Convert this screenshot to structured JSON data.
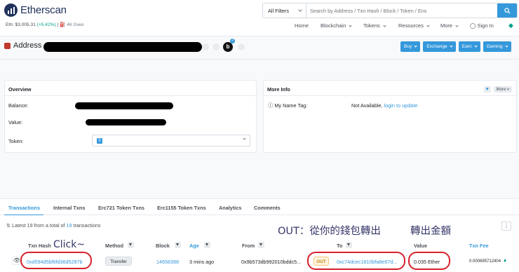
{
  "header": {
    "logo_text": "Etherscan",
    "eth_price_label": "Eth: $3,005.31",
    "eth_price_change": "(+5.42%)",
    "separator": "|",
    "gas": "46 Gwei",
    "search_filter": "All Filters",
    "search_placeholder": "Search by Address / Txn Hash / Block / Token / Ens",
    "nav": [
      "Home",
      "Blockchain",
      "Tokens",
      "Resources",
      "More",
      "Sign In"
    ]
  },
  "address_bar": {
    "label": "Address",
    "qr_badge": "b",
    "notification_count": "2",
    "buttons": [
      "Buy",
      "Exchange",
      "Earn",
      "Gaming"
    ]
  },
  "overview": {
    "title": "Overview",
    "balance_label": "Balance:",
    "value_label": "Value:",
    "token_label": "Token:",
    "token_count": "5"
  },
  "more_info": {
    "title": "More Info",
    "more_button": "More",
    "name_tag_label": "My Name Tag:",
    "name_tag_value": "Not Available,",
    "login_link": "login to update"
  },
  "tabs": [
    "Transactions",
    "Internal Txns",
    "Erc721 Token Txns",
    "Erc1155 Token Txns",
    "Analytics",
    "Comments"
  ],
  "tx_summary": "Latest 19 from a total of",
  "tx_total": "19",
  "tx_summary_suffix": "transactions",
  "table": {
    "headers": [
      "Txn Hash",
      "Method",
      "Block",
      "Age",
      "From",
      "To",
      "Value",
      "Txn Fee"
    ],
    "row": {
      "hash": "0xd594d5bf6fd36d5287b",
      "method": "Transfer",
      "block": "14658398",
      "age": "3 mins ago",
      "from": "0x9b573db992010bddc5...",
      "direction": "OUT",
      "to": "0xc74dcec1810bfa8e67d...",
      "value": "0.035 Ether",
      "fee": "0.000695712404"
    }
  },
  "annotations": {
    "click": "Click~",
    "out_note": "OUT：從你的錢包轉出",
    "amount_note": "轉出金額"
  },
  "colors": {
    "brand": "#21325b",
    "accent": "#3498db",
    "annotation_red": "#d6212b",
    "positive": "#00a186"
  }
}
